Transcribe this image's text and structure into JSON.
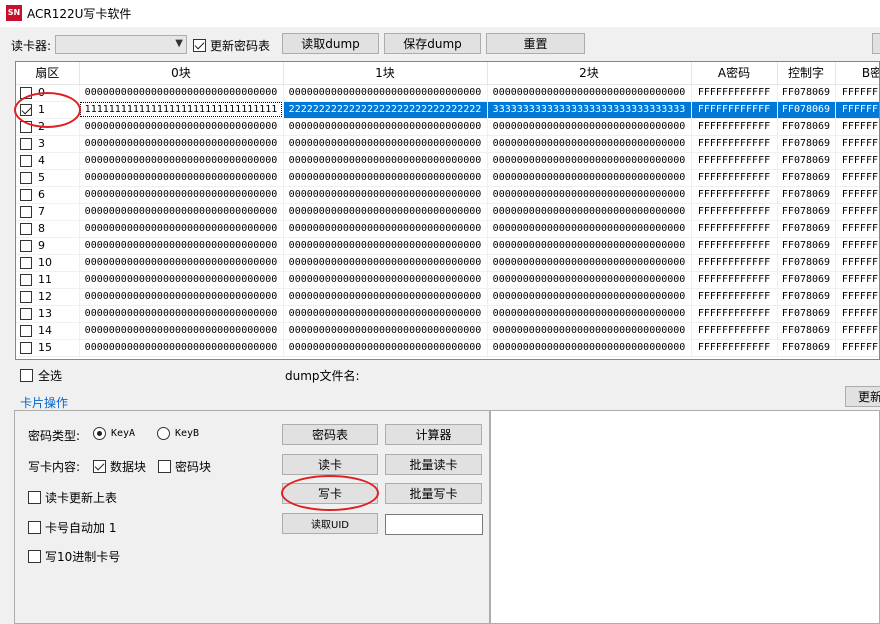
{
  "window": {
    "title": "ACR122U写卡软件",
    "icon_text": "SN"
  },
  "toolbar": {
    "reader_label": "读卡器:",
    "reader_value": "",
    "update_key_table_label": "更新密码表",
    "update_key_table_checked": true,
    "read_dump_label": "读取dump",
    "save_dump_label": "保存dump",
    "reset_label": "重置"
  },
  "grid": {
    "headers": [
      "扇区",
      "0块",
      "1块",
      "2块",
      "A密码",
      "控制字",
      "B密码"
    ],
    "selected_row": 1,
    "rows": [
      {
        "sector": "0",
        "checked": false,
        "b0": "00000000000000000000000000000000",
        "b1": "00000000000000000000000000000000",
        "b2": "00000000000000000000000000000000",
        "keyA": "FFFFFFFFFFFF",
        "ctrl": "FF078069",
        "keyB": "FFFFFFFFFFFF"
      },
      {
        "sector": "1",
        "checked": true,
        "b0": "11111111111111111111111111111111",
        "b1": "22222222222222222222222222222222",
        "b2": "33333333333333333333333333333333",
        "keyA": "FFFFFFFFFFFF",
        "ctrl": "FF078069",
        "keyB": "FFFFFFFFFFFF"
      },
      {
        "sector": "2",
        "checked": false,
        "b0": "00000000000000000000000000000000",
        "b1": "00000000000000000000000000000000",
        "b2": "00000000000000000000000000000000",
        "keyA": "FFFFFFFFFFFF",
        "ctrl": "FF078069",
        "keyB": "FFFFFFFFFFFF"
      },
      {
        "sector": "3",
        "checked": false,
        "b0": "00000000000000000000000000000000",
        "b1": "00000000000000000000000000000000",
        "b2": "00000000000000000000000000000000",
        "keyA": "FFFFFFFFFFFF",
        "ctrl": "FF078069",
        "keyB": "FFFFFFFFFFFF"
      },
      {
        "sector": "4",
        "checked": false,
        "b0": "00000000000000000000000000000000",
        "b1": "00000000000000000000000000000000",
        "b2": "00000000000000000000000000000000",
        "keyA": "FFFFFFFFFFFF",
        "ctrl": "FF078069",
        "keyB": "FFFFFFFFFFFF"
      },
      {
        "sector": "5",
        "checked": false,
        "b0": "00000000000000000000000000000000",
        "b1": "00000000000000000000000000000000",
        "b2": "00000000000000000000000000000000",
        "keyA": "FFFFFFFFFFFF",
        "ctrl": "FF078069",
        "keyB": "FFFFFFFFFFFF"
      },
      {
        "sector": "6",
        "checked": false,
        "b0": "00000000000000000000000000000000",
        "b1": "00000000000000000000000000000000",
        "b2": "00000000000000000000000000000000",
        "keyA": "FFFFFFFFFFFF",
        "ctrl": "FF078069",
        "keyB": "FFFFFFFFFFFF"
      },
      {
        "sector": "7",
        "checked": false,
        "b0": "00000000000000000000000000000000",
        "b1": "00000000000000000000000000000000",
        "b2": "00000000000000000000000000000000",
        "keyA": "FFFFFFFFFFFF",
        "ctrl": "FF078069",
        "keyB": "FFFFFFFFFFFF"
      },
      {
        "sector": "8",
        "checked": false,
        "b0": "00000000000000000000000000000000",
        "b1": "00000000000000000000000000000000",
        "b2": "00000000000000000000000000000000",
        "keyA": "FFFFFFFFFFFF",
        "ctrl": "FF078069",
        "keyB": "FFFFFFFFFFFF"
      },
      {
        "sector": "9",
        "checked": false,
        "b0": "00000000000000000000000000000000",
        "b1": "00000000000000000000000000000000",
        "b2": "00000000000000000000000000000000",
        "keyA": "FFFFFFFFFFFF",
        "ctrl": "FF078069",
        "keyB": "FFFFFFFFFFFF"
      },
      {
        "sector": "10",
        "checked": false,
        "b0": "00000000000000000000000000000000",
        "b1": "00000000000000000000000000000000",
        "b2": "00000000000000000000000000000000",
        "keyA": "FFFFFFFFFFFF",
        "ctrl": "FF078069",
        "keyB": "FFFFFFFFFFFF"
      },
      {
        "sector": "11",
        "checked": false,
        "b0": "00000000000000000000000000000000",
        "b1": "00000000000000000000000000000000",
        "b2": "00000000000000000000000000000000",
        "keyA": "FFFFFFFFFFFF",
        "ctrl": "FF078069",
        "keyB": "FFFFFFFFFFFF"
      },
      {
        "sector": "12",
        "checked": false,
        "b0": "00000000000000000000000000000000",
        "b1": "00000000000000000000000000000000",
        "b2": "00000000000000000000000000000000",
        "keyA": "FFFFFFFFFFFF",
        "ctrl": "FF078069",
        "keyB": "FFFFFFFFFFFF"
      },
      {
        "sector": "13",
        "checked": false,
        "b0": "00000000000000000000000000000000",
        "b1": "00000000000000000000000000000000",
        "b2": "00000000000000000000000000000000",
        "keyA": "FFFFFFFFFFFF",
        "ctrl": "FF078069",
        "keyB": "FFFFFFFFFFFF"
      },
      {
        "sector": "14",
        "checked": false,
        "b0": "00000000000000000000000000000000",
        "b1": "00000000000000000000000000000000",
        "b2": "00000000000000000000000000000000",
        "keyA": "FFFFFFFFFFFF",
        "ctrl": "FF078069",
        "keyB": "FFFFFFFFFFFF"
      },
      {
        "sector": "15",
        "checked": false,
        "b0": "00000000000000000000000000000000",
        "b1": "00000000000000000000000000000000",
        "b2": "00000000000000000000000000000000",
        "keyA": "FFFFFFFFFFFF",
        "ctrl": "FF078069",
        "keyB": "FFFFFFFFFFFF"
      }
    ]
  },
  "below_grid": {
    "select_all_label": "全选",
    "dump_filename_label": "dump文件名:",
    "update_button_label": "更新"
  },
  "card_ops": {
    "group_label": "卡片操作",
    "key_type_label": "密码类型:",
    "key_a_label": "KeyA",
    "key_b_label": "KeyB",
    "key_a_selected": true,
    "write_content_label": "写卡内容:",
    "data_block_label": "数据块",
    "data_block_checked": true,
    "key_block_label": "密码块",
    "key_block_checked": false,
    "read_update_label": "读卡更新上表",
    "auto_inc_label": "卡号自动加 1",
    "write_decimal_label": "写10进制卡号",
    "key_table_btn": "密码表",
    "calculator_btn": "计算器",
    "read_card_btn": "读卡",
    "batch_read_btn": "批量读卡",
    "write_card_btn": "写卡",
    "batch_write_btn": "批量写卡",
    "read_uid_btn": "读取UID",
    "uid_value": ""
  },
  "colors": {
    "selection": "#0078d7",
    "annotation": "#e02020",
    "brand_icon": "#c8102e"
  }
}
